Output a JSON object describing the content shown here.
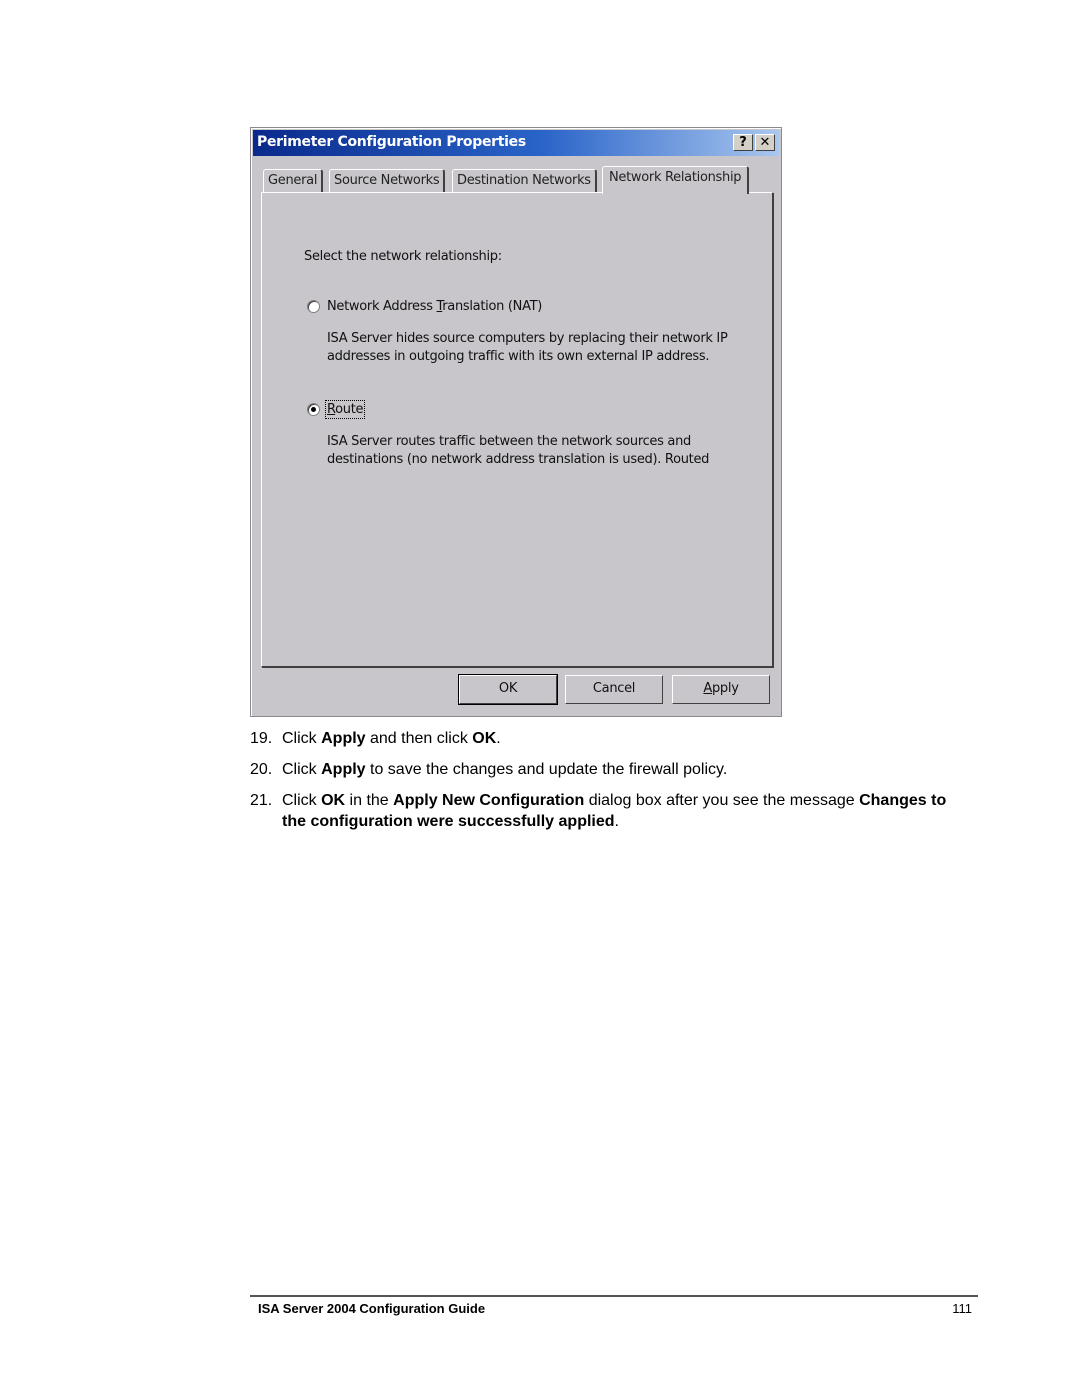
{
  "dialog": {
    "title": "Perimeter Configuration Properties",
    "help_button": "?",
    "close_button": "✕",
    "tabs": [
      {
        "label": "General",
        "active": false
      },
      {
        "label": "Source Networks",
        "active": false
      },
      {
        "label": "Destination Networks",
        "active": false
      },
      {
        "label": "Network Relationship",
        "active": true
      }
    ],
    "prompt": "Select the network relationship:",
    "options": [
      {
        "label_pre": "Network Address ",
        "label_accel": "T",
        "label_post": "ranslation (NAT)",
        "selected": false,
        "description": "ISA Server hides source computers by replacing their network IP addresses in outgoing traffic with its own external IP address."
      },
      {
        "label_pre": "",
        "label_accel": "R",
        "label_post": "oute",
        "selected": true,
        "description": "ISA Server routes traffic between the network sources and destinations (no network address translation is used). Routed"
      }
    ],
    "buttons": {
      "ok": "OK",
      "cancel": "Cancel",
      "apply_accel": "A",
      "apply_rest": "pply"
    }
  },
  "steps": [
    {
      "number": "19.",
      "parts": [
        {
          "text": "Click ",
          "bold": false
        },
        {
          "text": "Apply",
          "bold": true
        },
        {
          "text": " and then click ",
          "bold": false
        },
        {
          "text": "OK",
          "bold": true
        },
        {
          "text": ".",
          "bold": false
        }
      ]
    },
    {
      "number": "20.",
      "parts": [
        {
          "text": "Click ",
          "bold": false
        },
        {
          "text": "Apply",
          "bold": true
        },
        {
          "text": " to save the changes and update the firewall policy.",
          "bold": false
        }
      ]
    },
    {
      "number": "21.",
      "parts": [
        {
          "text": "Click ",
          "bold": false
        },
        {
          "text": "OK",
          "bold": true
        },
        {
          "text": " in the ",
          "bold": false
        },
        {
          "text": "Apply New Configuration",
          "bold": true
        },
        {
          "text": " dialog box after you see the message ",
          "bold": false
        },
        {
          "text": "Changes to the configuration were successfully applied",
          "bold": true
        },
        {
          "text": ".",
          "bold": false
        }
      ]
    }
  ],
  "footer": {
    "title": "ISA Server 2004 Configuration Guide",
    "page_number": "111"
  }
}
